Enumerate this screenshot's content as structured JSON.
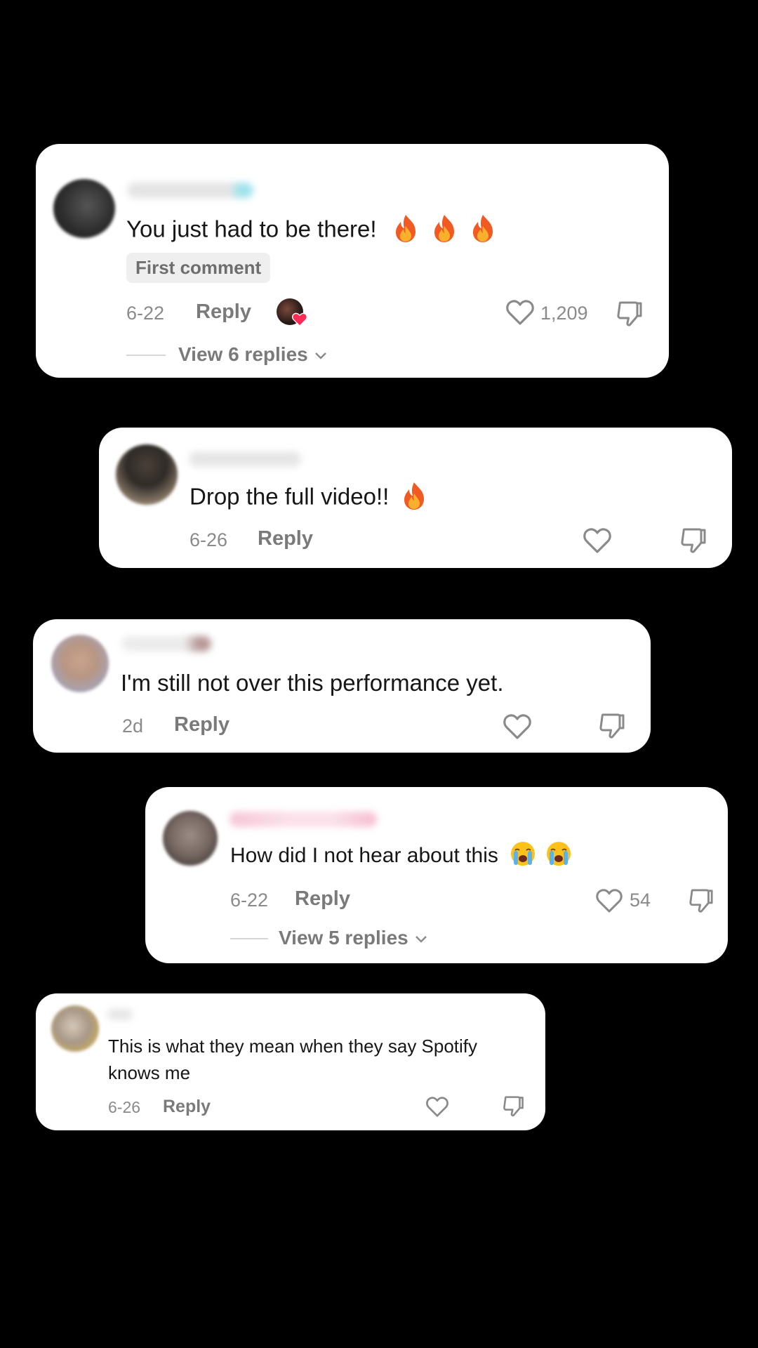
{
  "colors": {
    "background": "#000000",
    "card": "#ffffff",
    "text": "#161616",
    "muted": "#8a8a8a",
    "like_badge": "#fe2c55"
  },
  "comments": [
    {
      "text": "You just had to be there!",
      "emoji": [
        "fire-emoji",
        "fire-emoji",
        "fire-emoji"
      ],
      "tag": "First comment",
      "date": "6-22",
      "reply_label": "Reply",
      "likes": "1,209",
      "view_replies": "View 6 replies",
      "creator_liked": true
    },
    {
      "text": "Drop the full video!!",
      "emoji": [
        "fire-emoji"
      ],
      "date": "6-26",
      "reply_label": "Reply"
    },
    {
      "text": "I'm still not over this performance yet.",
      "date": "2d",
      "reply_label": "Reply"
    },
    {
      "text": "How did I not hear about this",
      "emoji": [
        "crying-emoji",
        "crying-emoji"
      ],
      "date": "6-22",
      "reply_label": "Reply",
      "likes": "54",
      "view_replies": "View 5 replies"
    },
    {
      "text_lines": [
        "This is what they mean when they say Spotify",
        "knows me"
      ],
      "date": "6-26",
      "reply_label": "Reply"
    }
  ]
}
